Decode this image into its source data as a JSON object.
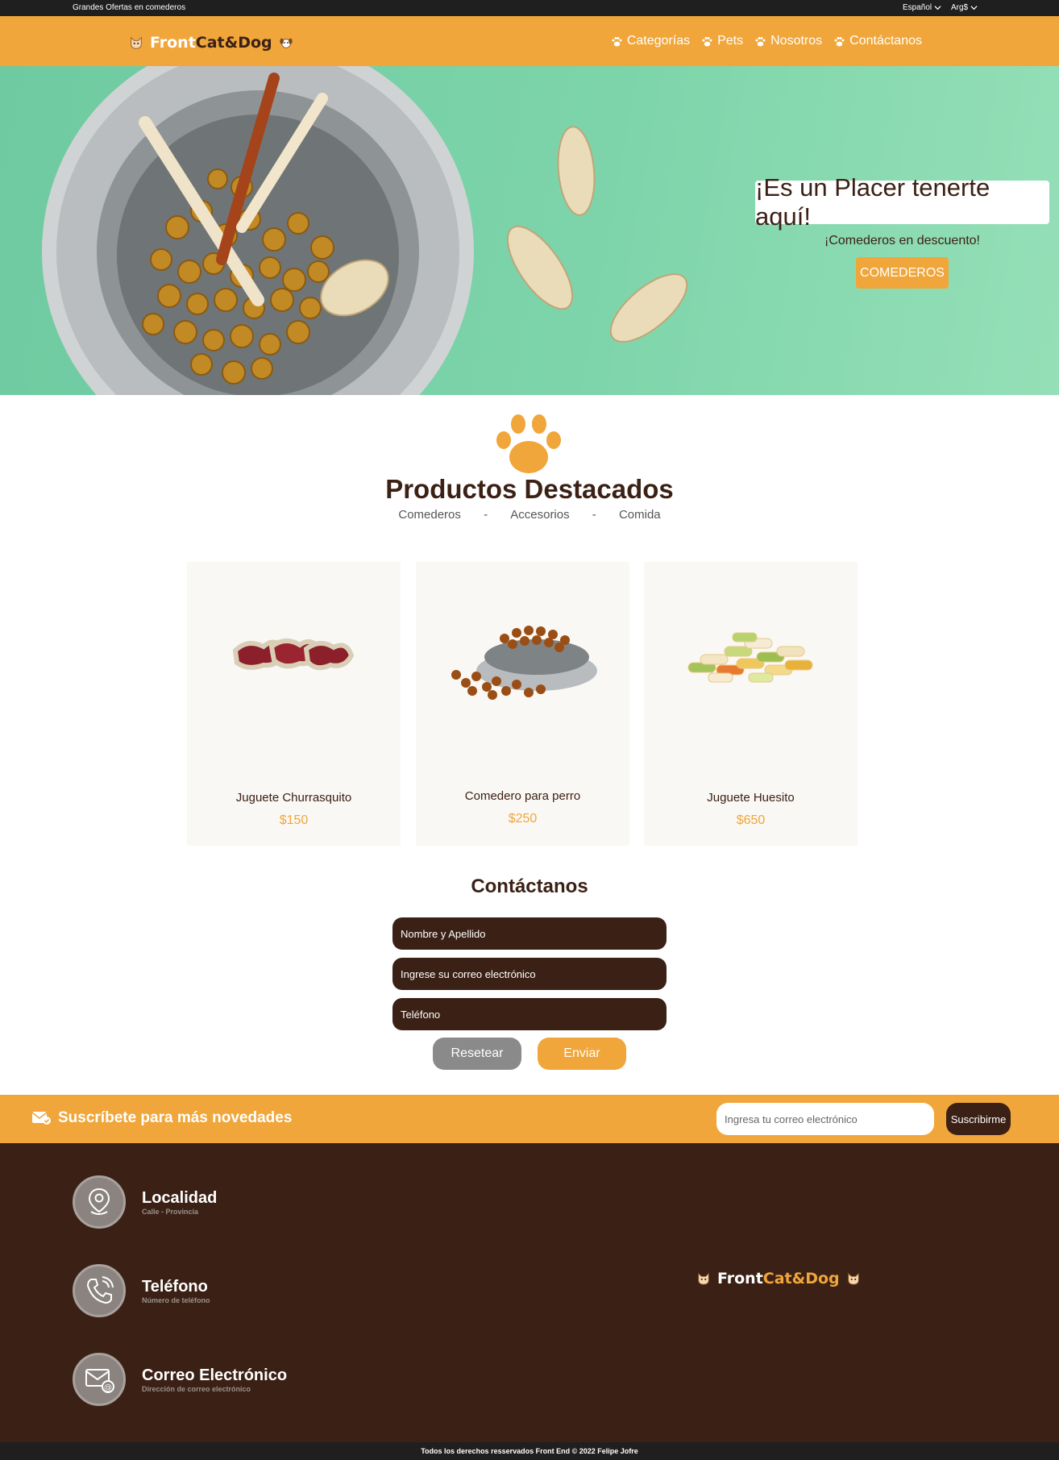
{
  "topbar": {
    "promo": "Grandes Ofertas en comederos",
    "language": "Español",
    "currency": "Arg$"
  },
  "brand": {
    "part1": "Front",
    "part2": "Cat&Dog"
  },
  "nav": {
    "items": [
      {
        "label": "Categorías"
      },
      {
        "label": "Pets"
      },
      {
        "label": "Nosotros"
      },
      {
        "label": "Contáctanos"
      }
    ]
  },
  "hero": {
    "title": "¡Es un Placer tenerte aquí!",
    "subtitle": "¡Comederos en descuento!",
    "button": "COMEDEROS"
  },
  "featured": {
    "title": "Productos Destacados",
    "filters": [
      "Comederos",
      "Accesorios",
      "Comida"
    ],
    "separator": "-",
    "products": [
      {
        "name": "Juguete Churrasquito",
        "price": "$150"
      },
      {
        "name": "Comedero para perro",
        "price": "$250"
      },
      {
        "name": "Juguete Huesito",
        "price": "$650"
      }
    ]
  },
  "contact": {
    "title": "Contáctanos",
    "name_placeholder": "Nombre y Apellido",
    "email_placeholder": "Ingrese su correo electrónico",
    "phone_placeholder": "Teléfono",
    "reset_label": "Resetear",
    "send_label": "Enviar"
  },
  "subscribe": {
    "label": "Suscríbete para más novedades",
    "placeholder": "Ingresa tu correo electrónico",
    "button": "Suscribirme"
  },
  "footer": {
    "items": [
      {
        "title": "Localidad",
        "subtitle": "Calle - Provincia",
        "icon": "location-pin-icon"
      },
      {
        "title": "Teléfono",
        "subtitle": "Número de teléfono",
        "icon": "phone-icon"
      },
      {
        "title": "Correo Electrónico",
        "subtitle": "Dirección de correo electrónico",
        "icon": "mail-icon"
      }
    ],
    "copyright": "Todos los derechos resservados Front End © 2022 Felipe Jofre"
  },
  "colors": {
    "accent": "#f0a63a",
    "dark_brown": "#3b2115",
    "hero_green": "#7dd4aa",
    "bar_dark": "#1f1f1f"
  }
}
